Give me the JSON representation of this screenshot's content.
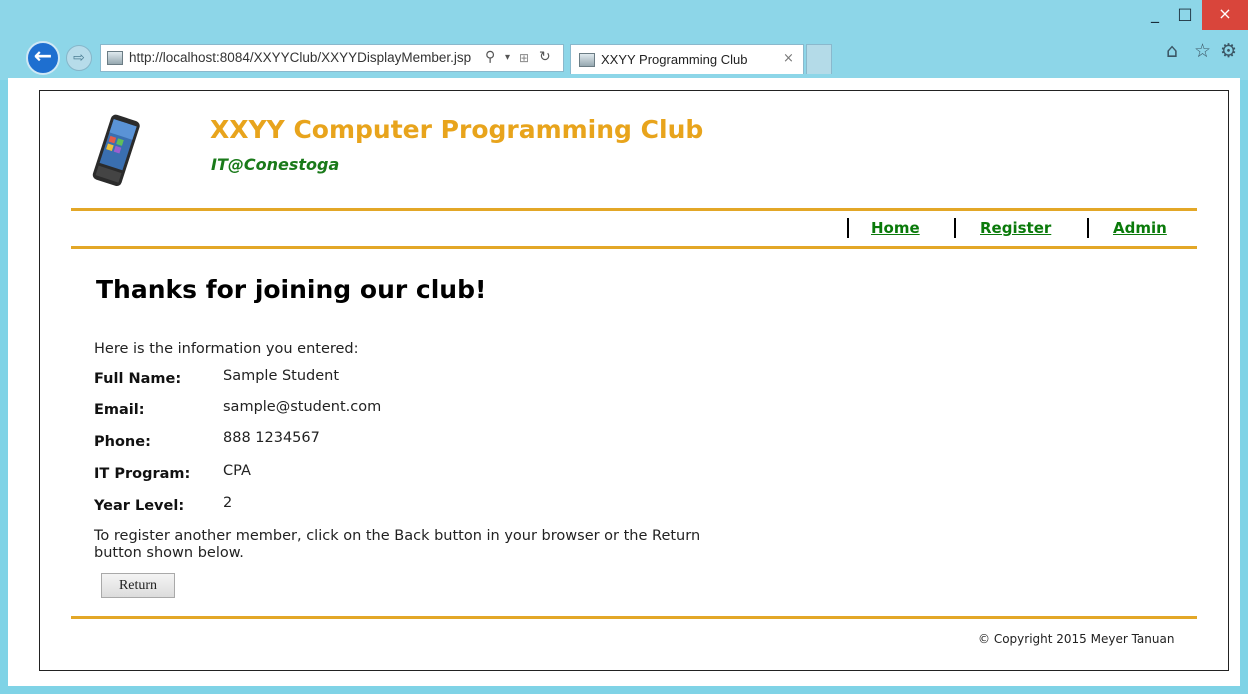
{
  "window": {
    "minimize_glyph": "_",
    "maximize_glyph": "□",
    "close_glyph": "×"
  },
  "browser": {
    "back_glyph": "←",
    "forward_glyph": "⇨",
    "url": "http://localhost:8084/XXYYClub/XXYYDisplayMember.jsp",
    "search_glyph": "⚲",
    "dropdown_glyph": "▾",
    "compat_glyph": "⊞",
    "refresh_glyph": "↻",
    "tab_title": "XXYY Programming Club",
    "tab_close": "×",
    "home_glyph": "⌂",
    "favorites_glyph": "☆",
    "tools_glyph": "⚙"
  },
  "header": {
    "title": "XXYY Computer Programming Club",
    "subtitle": "IT@Conestoga",
    "logo_icon": "smartphone-icon"
  },
  "nav": {
    "items": [
      {
        "label": "Home"
      },
      {
        "label": "Register"
      },
      {
        "label": "Admin"
      }
    ]
  },
  "main": {
    "heading": "Thanks for joining our club!",
    "intro": "Here is the information you entered:",
    "fields": [
      {
        "label": "Full Name:",
        "value": "Sample Student"
      },
      {
        "label": "Email:",
        "value": "sample@student.com"
      },
      {
        "label": "Phone:",
        "value": "888 1234567"
      },
      {
        "label": "IT Program:",
        "value": "CPA"
      },
      {
        "label": "Year Level:",
        "value": "2"
      }
    ],
    "note": "To register another member, click on the Back button in your browser or the Return button shown below.",
    "return_button": "Return"
  },
  "footer": {
    "copyright": "© Copyright 2015 Meyer Tanuan"
  },
  "colors": {
    "accent": "#e3a727",
    "title": "#e8a41c",
    "link": "#0a7a0a",
    "subtitle": "#1a7a1a"
  }
}
